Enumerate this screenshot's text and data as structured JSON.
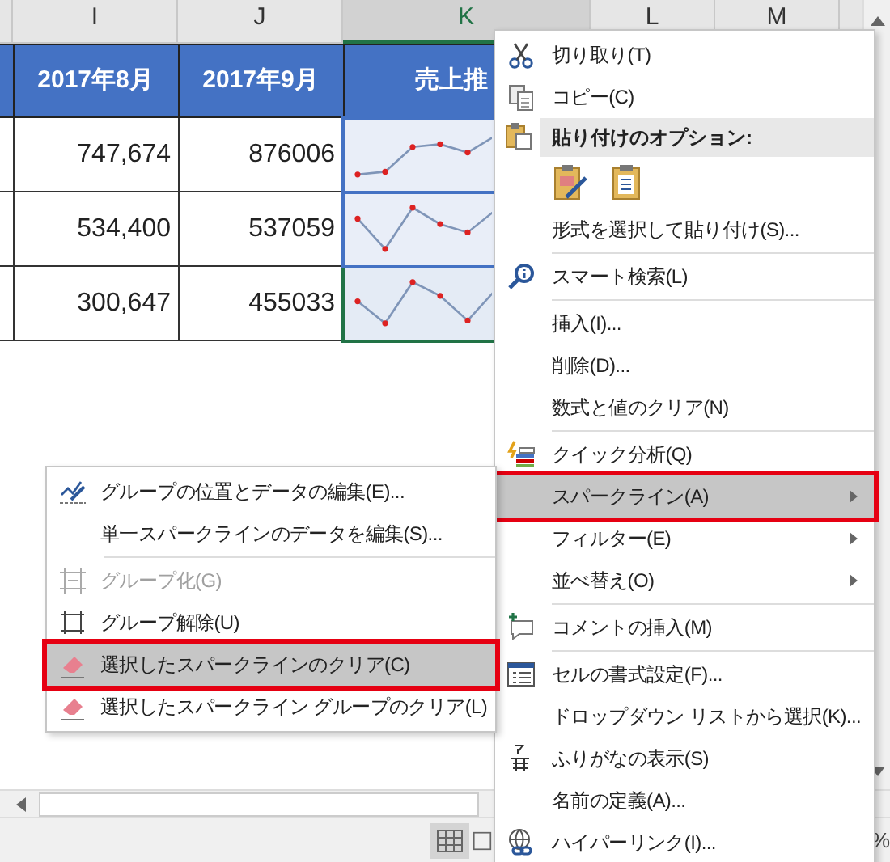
{
  "sheet": {
    "columns": [
      {
        "label": "I",
        "selected": false
      },
      {
        "label": "J",
        "selected": false
      },
      {
        "label": "K",
        "selected": true
      },
      {
        "label": "L",
        "selected": false
      },
      {
        "label": "M",
        "selected": false
      }
    ],
    "title_row": [
      "2017年8月",
      "2017年9月",
      "売上推"
    ],
    "rows": [
      {
        "cells": [
          "747,674",
          "876006"
        ],
        "sparkline": {
          "selected": false
        }
      },
      {
        "cells": [
          "534,400",
          "537059"
        ],
        "sparkline": {
          "selected": false
        }
      },
      {
        "cells": [
          "300,647",
          "455033"
        ],
        "sparkline": {
          "selected": true
        }
      }
    ]
  },
  "context_menu": {
    "items": [
      {
        "kind": "item",
        "label": "切り取り(T)",
        "selected": false,
        "highlighted": false,
        "has_submenu": false
      },
      {
        "kind": "item",
        "label": "コピー(C)",
        "selected": false,
        "highlighted": false,
        "has_submenu": false
      },
      {
        "kind": "header",
        "label": "貼り付けのオプション:"
      },
      {
        "kind": "paste_options"
      },
      {
        "kind": "item",
        "label": "形式を選択して貼り付け(S)...",
        "selected": false,
        "highlighted": false,
        "has_submenu": false
      },
      {
        "kind": "separator"
      },
      {
        "kind": "item",
        "label": "スマート検索(L)",
        "selected": false,
        "highlighted": false,
        "has_submenu": false
      },
      {
        "kind": "separator"
      },
      {
        "kind": "item",
        "label": "挿入(I)...",
        "selected": false,
        "highlighted": false,
        "has_submenu": false
      },
      {
        "kind": "item",
        "label": "削除(D)...",
        "selected": false,
        "highlighted": false,
        "has_submenu": false
      },
      {
        "kind": "item",
        "label": "数式と値のクリア(N)",
        "selected": false,
        "highlighted": false,
        "has_submenu": false
      },
      {
        "kind": "separator"
      },
      {
        "kind": "item",
        "label": "クイック分析(Q)",
        "selected": false,
        "highlighted": false,
        "has_submenu": false
      },
      {
        "kind": "item",
        "label": "スパークライン(A)",
        "selected": true,
        "highlighted": true,
        "has_submenu": true
      },
      {
        "kind": "item",
        "label": "フィルター(E)",
        "selected": false,
        "highlighted": false,
        "has_submenu": true
      },
      {
        "kind": "item",
        "label": "並べ替え(O)",
        "selected": false,
        "highlighted": false,
        "has_submenu": true
      },
      {
        "kind": "separator"
      },
      {
        "kind": "item",
        "label": "コメントの挿入(M)",
        "selected": false,
        "highlighted": false,
        "has_submenu": false
      },
      {
        "kind": "separator"
      },
      {
        "kind": "item",
        "label": "セルの書式設定(F)...",
        "selected": false,
        "highlighted": false,
        "has_submenu": false
      },
      {
        "kind": "item",
        "label": "ドロップダウン リストから選択(K)...",
        "selected": false,
        "highlighted": false,
        "has_submenu": false
      },
      {
        "kind": "item",
        "label": "ふりがなの表示(S)",
        "selected": false,
        "highlighted": false,
        "has_submenu": false
      },
      {
        "kind": "item",
        "label": "名前の定義(A)...",
        "selected": false,
        "highlighted": false,
        "has_submenu": false
      },
      {
        "kind": "item",
        "label": "ハイパーリンク(I)...",
        "selected": false,
        "highlighted": false,
        "has_submenu": false
      }
    ]
  },
  "submenu": {
    "items": [
      {
        "kind": "item",
        "label": "グループの位置とデータの編集(E)...",
        "selected": false,
        "highlighted": false,
        "disabled": false
      },
      {
        "kind": "item",
        "label": "単一スパークラインのデータを編集(S)...",
        "selected": false,
        "highlighted": false,
        "disabled": false
      },
      {
        "kind": "separator"
      },
      {
        "kind": "item",
        "label": "グループ化(G)",
        "selected": false,
        "highlighted": false,
        "disabled": true
      },
      {
        "kind": "item",
        "label": "グループ解除(U)",
        "selected": false,
        "highlighted": false,
        "disabled": false
      },
      {
        "kind": "item",
        "label": "選択したスパークラインのクリア(C)",
        "selected": true,
        "highlighted": true,
        "disabled": false
      },
      {
        "kind": "item",
        "label": "選択したスパークライン グループのクリア(L)",
        "selected": false,
        "highlighted": false,
        "disabled": false
      }
    ]
  },
  "status_bar": {
    "view_buttons": [
      {
        "selected": true
      },
      {
        "selected": false
      }
    ],
    "zoom": "%"
  }
}
